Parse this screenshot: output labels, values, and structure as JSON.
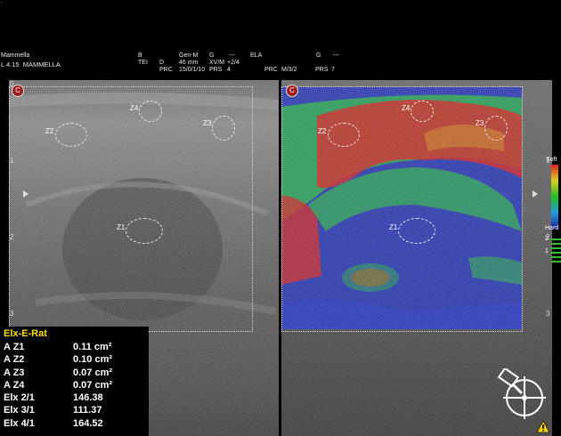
{
  "header": {
    "probe_line1": "Mammella",
    "probe_line2": "L 4.15  MAMMELLA",
    "col_b": "B",
    "col_tei": "TEI",
    "col_d": "D",
    "col_prc": "PRC",
    "col_genm": "Gen-M",
    "col_depth": "46 mm",
    "col_prc_val": "15/0/1/10",
    "col_g": "G",
    "col_xvm": "XV/M",
    "col_prs": "PRS",
    "col_prs_val": "4",
    "col_dash": "---",
    "col_gain": "+2/4",
    "col_ela": "ELA",
    "col_prc2": "PRC",
    "col_prc2_val": "M/3/2",
    "col_g2": "G",
    "col_dash2": "---",
    "col_prs2": "PRS",
    "col_prs2_val": "7"
  },
  "left_image": {
    "marker": "C",
    "depth_ticks": [
      "0",
      "1",
      "2",
      "3"
    ],
    "zones": [
      "Z4",
      "Z3",
      "Z2",
      "Z1"
    ]
  },
  "right_image": {
    "marker": "C",
    "depth_ticks": [
      "1",
      "2",
      "3"
    ],
    "zones": [
      "Z4",
      "Z3",
      "Z2",
      "Z1"
    ]
  },
  "colorbar": {
    "top_label": "Soft",
    "bottom_label": "Hard",
    "stiff_top": "2",
    "stiff_mid": "1"
  },
  "measurements": {
    "title": "Elx-E-Rat",
    "rows": [
      {
        "label": "A Z1",
        "value": "0.11 cm²"
      },
      {
        "label": "A Z2",
        "value": "0.10 cm²"
      },
      {
        "label": "A Z3",
        "value": "0.07 cm²"
      },
      {
        "label": "A Z4",
        "value": "0.07 cm²"
      },
      {
        "label": "Elx 2/1",
        "value": "146.38"
      },
      {
        "label": "Elx 3/1",
        "value": "111.37"
      },
      {
        "label": "Elx 4/1",
        "value": "164.52"
      }
    ]
  },
  "warning_icon": "warning-icon",
  "orientation_icon": "probe-orientation-icon"
}
